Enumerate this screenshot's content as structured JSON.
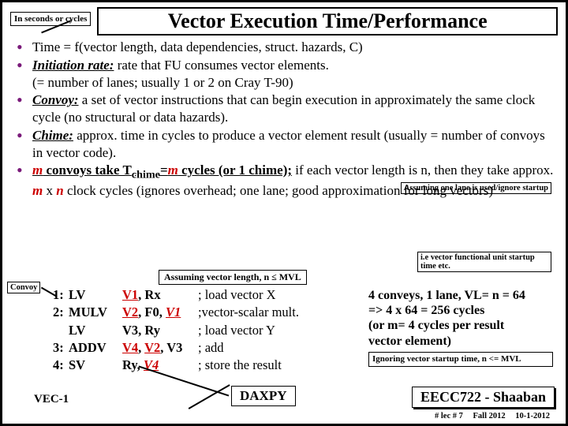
{
  "header": {
    "tag": "In seconds or cycles",
    "title": "Vector Execution Time/Performance"
  },
  "bullets": {
    "b1": "Time = f(vector length, data dependencies, struct. hazards, C)",
    "b2a": "Initiation rate:",
    "b2b": " rate that FU consumes vector elements.",
    "b2c": "(= number of lanes; usually 1 or  2 on Cray T-90)",
    "b3a": "Convoy:",
    "b3b": " a set of vector instructions that can begin execution in approximately the same clock cycle (no structural or data hazards).",
    "b4a": "Chime:",
    "b4b": "  approx. time in cycles to produce a vector element result (usually = number of convoys in vector code).",
    "b5a": "m",
    "b5b": " convoys take T",
    "b5sub": "chime",
    "b5c": "=",
    "b5d": "m",
    "b5e": " cycles (or 1 chime);",
    "b5f": " if each vector length is n, then they take approx.  ",
    "b5g": "m",
    "b5h": " x ",
    "b5i": "n",
    "b5j": " clock cycles (ignores overhead; one lane; good approximation for long vectors)"
  },
  "notes": {
    "n1": "Assuming one lane is used/ignore startup",
    "n2": "i.e vector functional unit startup time etc.",
    "mid": "Assuming vector length,  n  ≤  MVL",
    "convoy": "Convoy"
  },
  "code": [
    {
      "n": "1:",
      "op": "LV",
      "args_plain": "",
      "vreg": "V1",
      "args_post": ", Rx",
      "c": "; load vector X"
    },
    {
      "n": "2:",
      "op": "MULV",
      "args_plain": "",
      "vreg": "V2",
      "args_post": ", F0, ",
      "vreg2": "V1",
      "c": " ;vector-scalar mult."
    },
    {
      "n": "",
      "op": "LV",
      "args_plain": "V3, Ry",
      "vreg": "",
      "args_post": "",
      "c": "; load vector Y"
    },
    {
      "n": "3:",
      "op": "ADDV",
      "args_plain": "",
      "vreg": "V4",
      "args_post": ", ",
      "vreg2": "V2",
      "args_post2": ", V3",
      "c": " ; add"
    },
    {
      "n": "4:",
      "op": "SV",
      "args_plain": "Ry, ",
      "vreg": "V4",
      "args_post": "",
      "c": "; store the result"
    }
  ],
  "aside": {
    "l1": "4 conveys, 1 lane, VL= n = 64",
    "l2": "=> 4 x 64 = 256 cycles",
    "l3": "(or m= 4 cycles per result",
    "l4": "vector element)",
    "box": "Ignoring vector startup time, n <= MVL"
  },
  "daxpy": "DAXPY",
  "vec1": "VEC-1",
  "course": "EECC722 - Shaaban",
  "foot": {
    "a": "#  lec # 7",
    "b": "Fall 2012",
    "c": "10-1-2012"
  }
}
